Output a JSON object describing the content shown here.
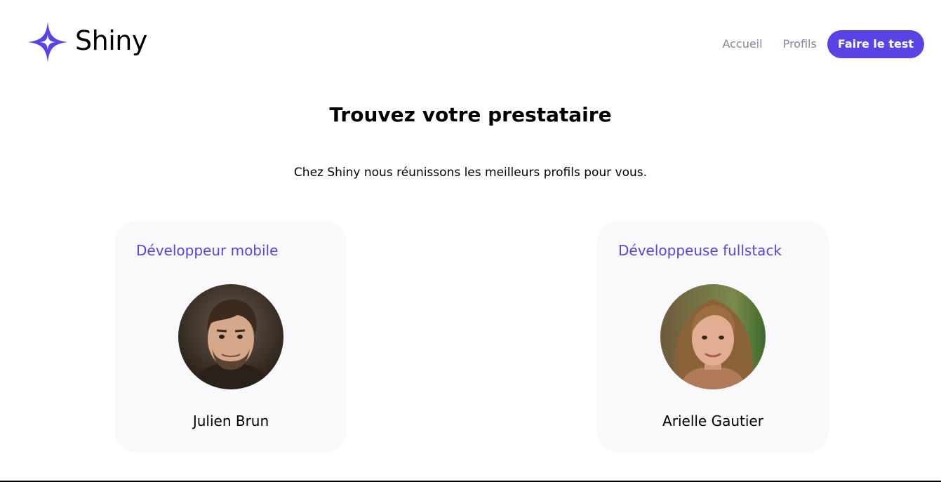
{
  "header": {
    "logo_text": "Shiny",
    "logo_icon": "sparkle-star-icon",
    "nav": {
      "home_label": "Accueil",
      "profiles_label": "Profils",
      "test_button_label": "Faire le test"
    }
  },
  "main": {
    "title": "Trouvez votre prestataire",
    "subtitle": "Chez Shiny nous réunissons les meilleurs profils pour vous."
  },
  "profiles": [
    {
      "job": "Développeur mobile",
      "name": "Julien Brun"
    },
    {
      "job": "Développeuse fullstack",
      "name": "Arielle Gautier"
    }
  ],
  "colors": {
    "primary": "#5843E4",
    "nav_link": "#8186A0",
    "card_background": "#F9F9FC"
  }
}
